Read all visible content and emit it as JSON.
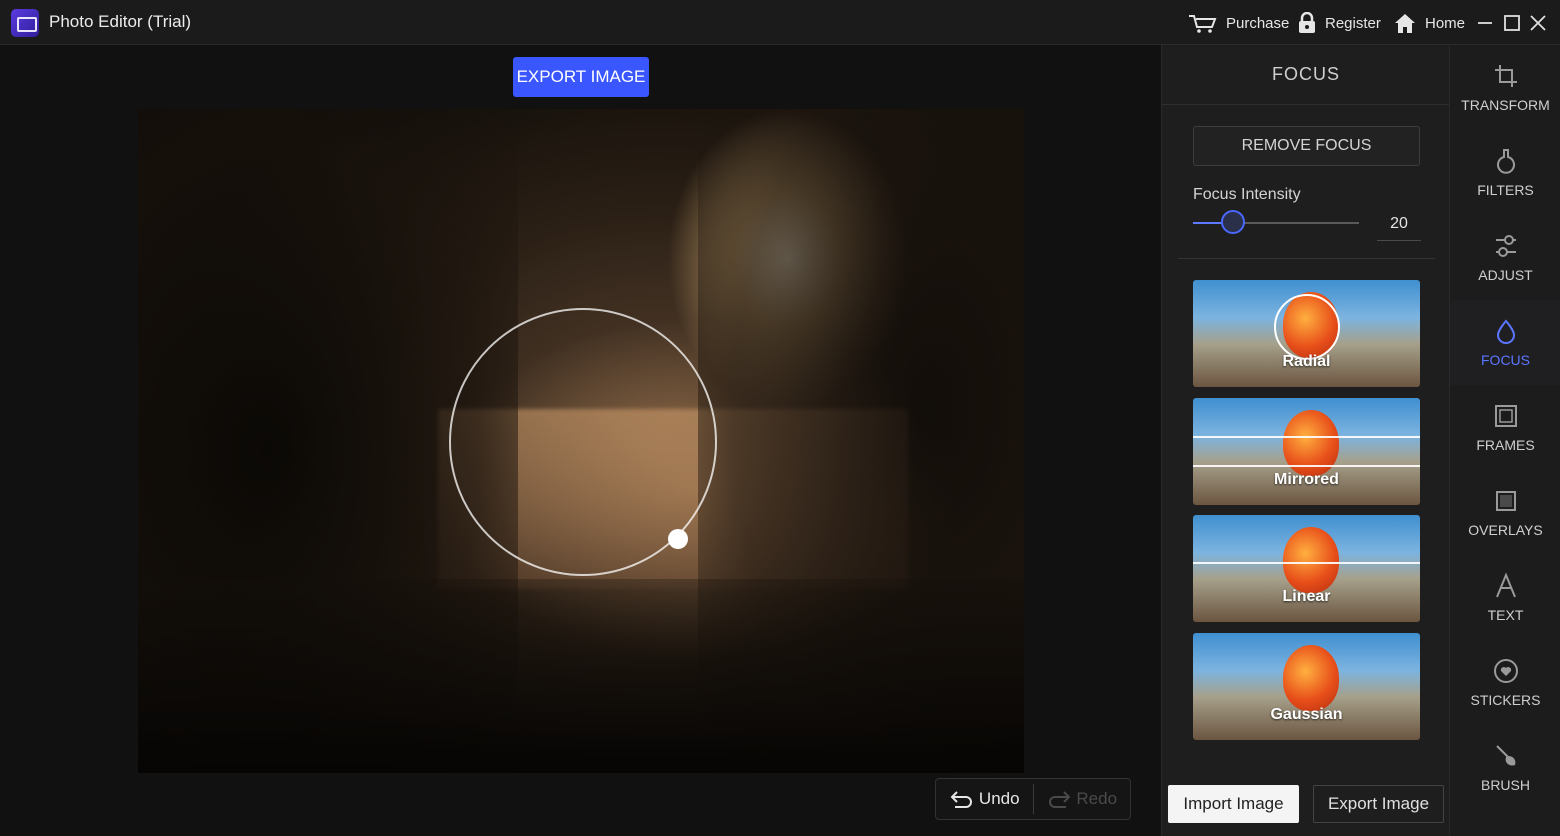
{
  "window": {
    "title": "Photo Editor (Trial)",
    "purchase": "Purchase",
    "register": "Register",
    "home": "Home"
  },
  "canvas": {
    "export_button": "EXPORT IMAGE",
    "undo": "Undo",
    "redo": "Redo"
  },
  "focus_panel": {
    "title": "FOCUS",
    "remove_button": "REMOVE FOCUS",
    "intensity_label": "Focus Intensity",
    "intensity_value": "20",
    "intensity_fraction": 0.24,
    "types": [
      {
        "label": "Radial"
      },
      {
        "label": "Mirrored"
      },
      {
        "label": "Linear"
      },
      {
        "label": "Gaussian"
      }
    ],
    "import_button": "Import Image",
    "export_button": "Export Image"
  },
  "tools": [
    {
      "label": "TRANSFORM",
      "icon": "crop-icon"
    },
    {
      "label": "FILTERS",
      "icon": "filter-flask-icon"
    },
    {
      "label": "ADJUST",
      "icon": "adjust-sliders-icon"
    },
    {
      "label": "FOCUS",
      "icon": "drop-icon",
      "active": true
    },
    {
      "label": "FRAMES",
      "icon": "frame-icon"
    },
    {
      "label": "OVERLAYS",
      "icon": "overlay-icon"
    },
    {
      "label": "TEXT",
      "icon": "text-a-icon"
    },
    {
      "label": "STICKERS",
      "icon": "sticker-heart-icon"
    },
    {
      "label": "BRUSH",
      "icon": "brush-icon"
    }
  ],
  "colors": {
    "accent": "#3a56ff",
    "active_tool": "#5b76ff",
    "background": "#111111"
  }
}
